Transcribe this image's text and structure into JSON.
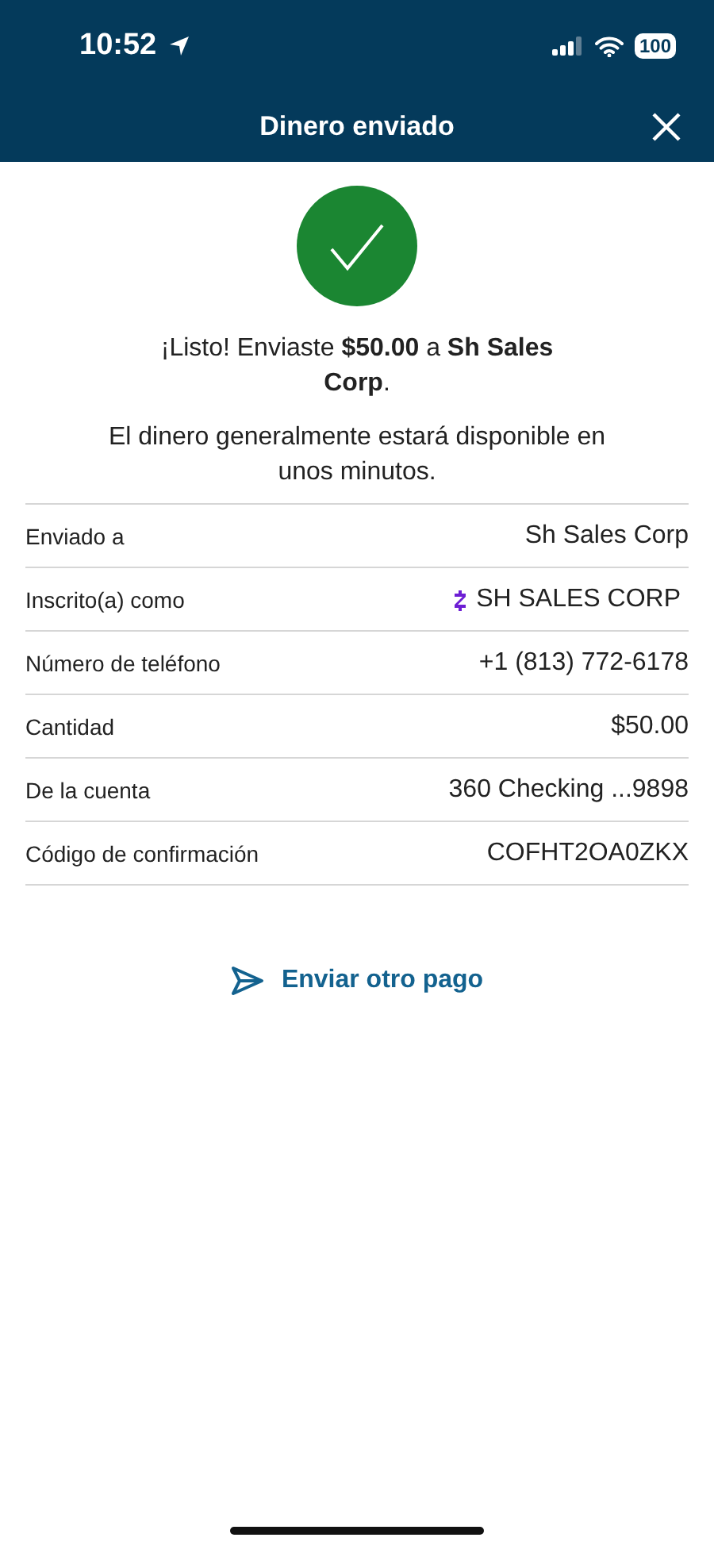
{
  "status_bar": {
    "time": "10:52",
    "battery": "100"
  },
  "header": {
    "title": "Dinero enviado"
  },
  "confirmation": {
    "message": "¡Listo! Enviaste **$50.00** a **Sh Sales Corp**.",
    "note": "El dinero generalmente estará disponible en unos minutos."
  },
  "details": [
    {
      "kind": "plain",
      "label": "Enviado a",
      "value": "Sh Sales Corp"
    },
    {
      "kind": "zelle",
      "label": "Inscrito(a) como",
      "value": "SH SALES CORP"
    },
    {
      "kind": "plain",
      "label": "Número de teléfono",
      "value": "+1 (813) 772-6178"
    },
    {
      "kind": "plain",
      "label": "Cantidad",
      "value": "$50.00"
    },
    {
      "kind": "plain",
      "label": "De la cuenta",
      "value": "360 Checking ...9898"
    },
    {
      "kind": "plain",
      "label": "Código de confirmación",
      "value": "COFHT2OA0ZKX"
    }
  ],
  "action": {
    "label": "Enviar otro pago"
  }
}
